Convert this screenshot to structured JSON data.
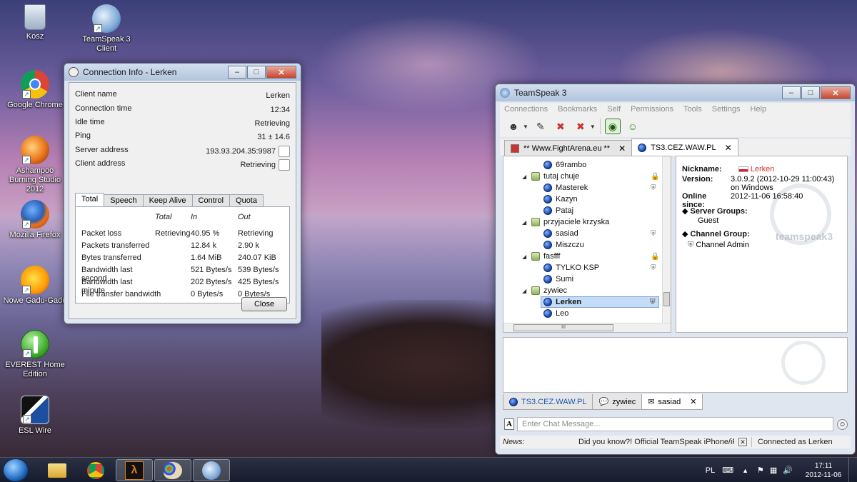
{
  "desktop": {
    "icons": [
      {
        "label": "Kosz"
      },
      {
        "label": "TeamSpeak 3 Client"
      },
      {
        "label": "Google Chrome"
      },
      {
        "label": "Ashampoo Burning Studio 2012"
      },
      {
        "label": "Mozilla Firefox"
      },
      {
        "label": "Nowe Gadu-Gadu"
      },
      {
        "label": "EVEREST Home Edition"
      },
      {
        "label": "ESL Wire"
      }
    ]
  },
  "connection_info": {
    "title": "Connection Info - Lerken",
    "rows": [
      {
        "label": "Client name",
        "value": "Lerken"
      },
      {
        "label": "Connection time",
        "value": "12:34"
      },
      {
        "label": "Idle time",
        "value": "Retrieving"
      },
      {
        "label": "Ping",
        "value": "31 ± 14.6"
      },
      {
        "label": "Server address",
        "value": "193.93.204.35:9987"
      },
      {
        "label": "Client address",
        "value": "Retrieving"
      }
    ],
    "tabs": [
      "Total",
      "Speech",
      "Keep Alive",
      "Control",
      "Quota"
    ],
    "active_tab": "Total",
    "stats_headers": {
      "total": "Total",
      "in": "In",
      "out": "Out"
    },
    "stats": [
      {
        "label": "Packet loss",
        "total": "Retrieving",
        "in": "40.95 %",
        "out": "Retrieving"
      },
      {
        "label": "Packets transferred",
        "total": "",
        "in": "12.84 k",
        "out": "2.90 k"
      },
      {
        "label": "Bytes transferred",
        "total": "",
        "in": "1.64 MiB",
        "out": "240.07 KiB"
      },
      {
        "label": "Bandwidth last second",
        "total": "",
        "in": "521 Bytes/s",
        "out": "539 Bytes/s"
      },
      {
        "label": "Bandwidth last minute",
        "total": "",
        "in": "202 Bytes/s",
        "out": "425 Bytes/s"
      },
      {
        "label": "File transfer bandwidth",
        "total": "",
        "in": "0 Bytes/s",
        "out": "0 Bytes/s"
      }
    ],
    "close_label": "Close"
  },
  "teamspeak": {
    "title": "TeamSpeak 3",
    "menu": [
      "Connections",
      "Bookmarks",
      "Self",
      "Permissions",
      "Tools",
      "Settings",
      "Help"
    ],
    "server_tabs": [
      {
        "label": "** Www.FightArena.eu **",
        "close": "✕"
      },
      {
        "label": "TS3.CEZ.WAW.PL",
        "close": "✕"
      }
    ],
    "tree": [
      {
        "type": "user",
        "name": "69rambo"
      },
      {
        "type": "channel",
        "name": "tutaj chuje",
        "expander": "◢"
      },
      {
        "type": "user",
        "name": "Masterek"
      },
      {
        "type": "user",
        "name": "Kazyn"
      },
      {
        "type": "user",
        "name": "Pataj"
      },
      {
        "type": "channel",
        "name": "przyjaciele krzyska",
        "expander": "◢"
      },
      {
        "type": "user",
        "name": "sasiad"
      },
      {
        "type": "user",
        "name": "Miszczu"
      },
      {
        "type": "channel",
        "name": "fasfff",
        "expander": "◢"
      },
      {
        "type": "user",
        "name": "TYLKO KSP"
      },
      {
        "type": "user",
        "name": "Sumi"
      },
      {
        "type": "channel",
        "name": "zywiec",
        "expander": "◢"
      },
      {
        "type": "user",
        "name": "Lerken"
      },
      {
        "type": "user",
        "name": "Leo"
      }
    ],
    "tree_scroll_label": "III",
    "info": {
      "nickname_label": "Nickname:",
      "nickname": "Lerken",
      "version_label": "Version:",
      "version": "3.0.9.2 (2012-10-29 11:00:43) on Windows",
      "online_label": "Online since:",
      "online": "2012-11-06 16:58:40",
      "server_groups_label": "Server Groups:",
      "server_group": "Guest",
      "channel_group_label": "Channel Group:",
      "channel_group": "Channel Admin",
      "watermark": "teamspeak3"
    },
    "chat_tabs": [
      {
        "label": "TS3.CEZ.WAW.PL"
      },
      {
        "label": "zywiec"
      },
      {
        "label": "sasiad",
        "close": "✕"
      }
    ],
    "chat_placeholder": "Enter Chat Message...",
    "status": {
      "news_label": "News:",
      "news": "Did you know?! Official TeamSpeak iPhone/iPad/iPo",
      "news_close": "✕",
      "connected": "Connected as Lerken"
    }
  },
  "taskbar": {
    "language": "PL",
    "time": "17:11",
    "date": "2012-11-06"
  }
}
